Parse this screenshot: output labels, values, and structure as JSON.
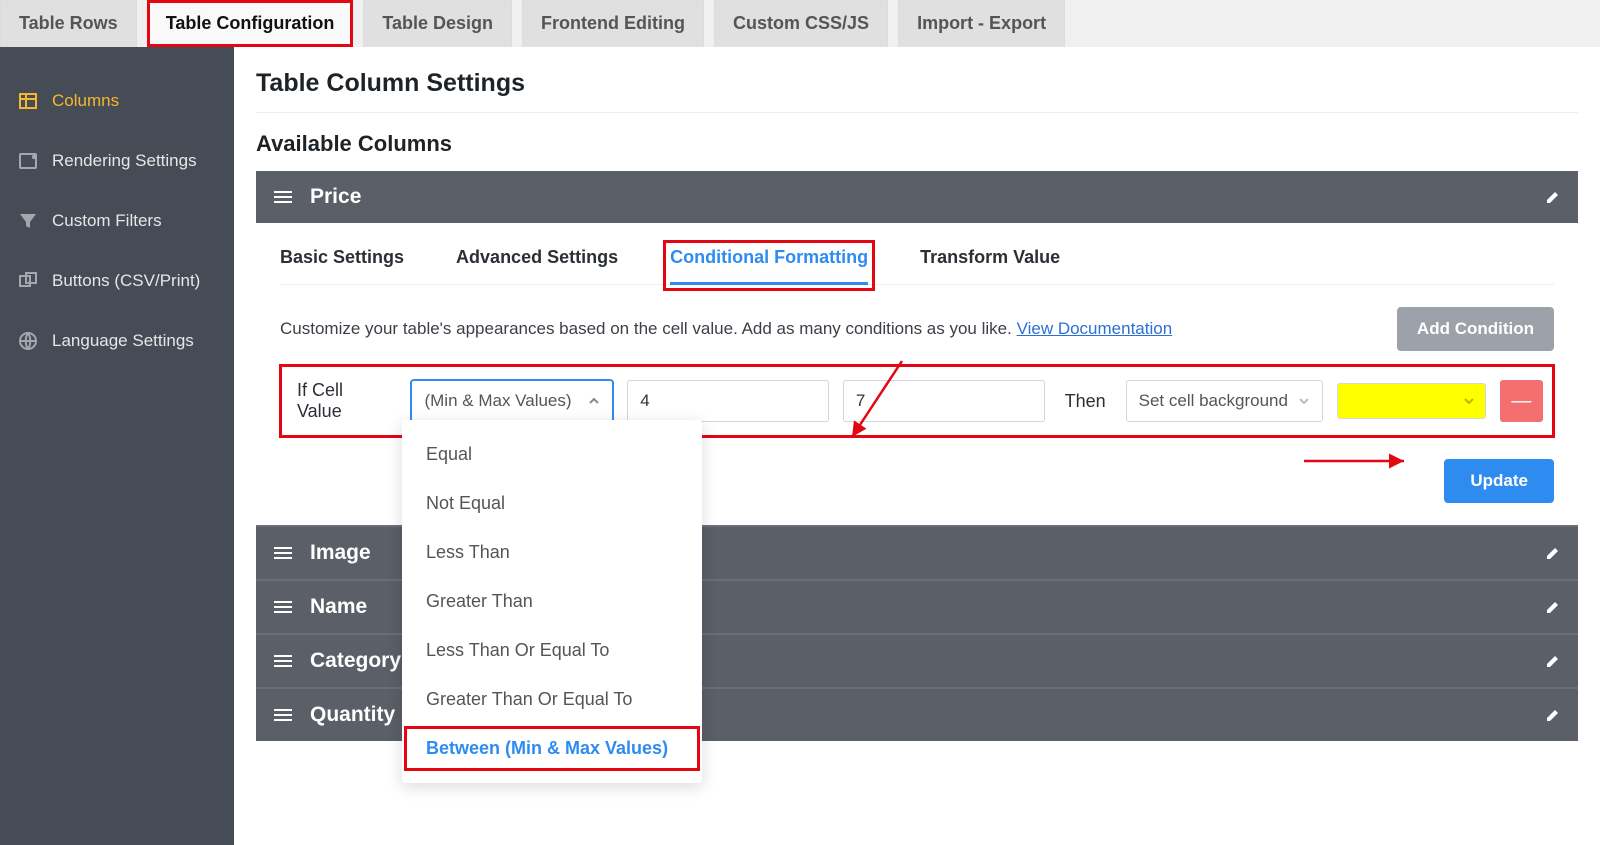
{
  "top_tabs": {
    "rows": "Table Rows",
    "config": "Table Configuration",
    "design": "Table Design",
    "frontend": "Frontend Editing",
    "css": "Custom CSS/JS",
    "import": "Import - Export"
  },
  "sidebar": {
    "columns": "Columns",
    "rendering": "Rendering Settings",
    "filters": "Custom Filters",
    "buttons": "Buttons (CSV/Print)",
    "language": "Language Settings"
  },
  "page": {
    "title": "Table Column Settings",
    "section": "Available Columns"
  },
  "columns": {
    "price": "Price",
    "image": "Image",
    "name": "Name",
    "category": "Category",
    "quantity": "Quantity"
  },
  "inner_tabs": {
    "basic": "Basic Settings",
    "advanced": "Advanced Settings",
    "conditional": "Conditional Formatting",
    "transform": "Transform Value"
  },
  "desc": {
    "text": "Customize your table's appearances based on the cell value. Add as many conditions as you like. ",
    "link": "View Documentation"
  },
  "buttons": {
    "add_condition": "Add Condition",
    "update": "Update"
  },
  "condition": {
    "if_label": "If Cell Value",
    "operator": "(Min & Max Values)",
    "min": "4",
    "max": "7",
    "then_label": "Then",
    "action": "Set cell background",
    "remove_glyph": "—"
  },
  "dropdown": {
    "equal": "Equal",
    "not_equal": "Not Equal",
    "less": "Less Than",
    "greater": "Greater Than",
    "lte": "Less Than Or Equal To",
    "gte": "Greater Than Or Equal To",
    "between": "Between (Min & Max Values)"
  }
}
